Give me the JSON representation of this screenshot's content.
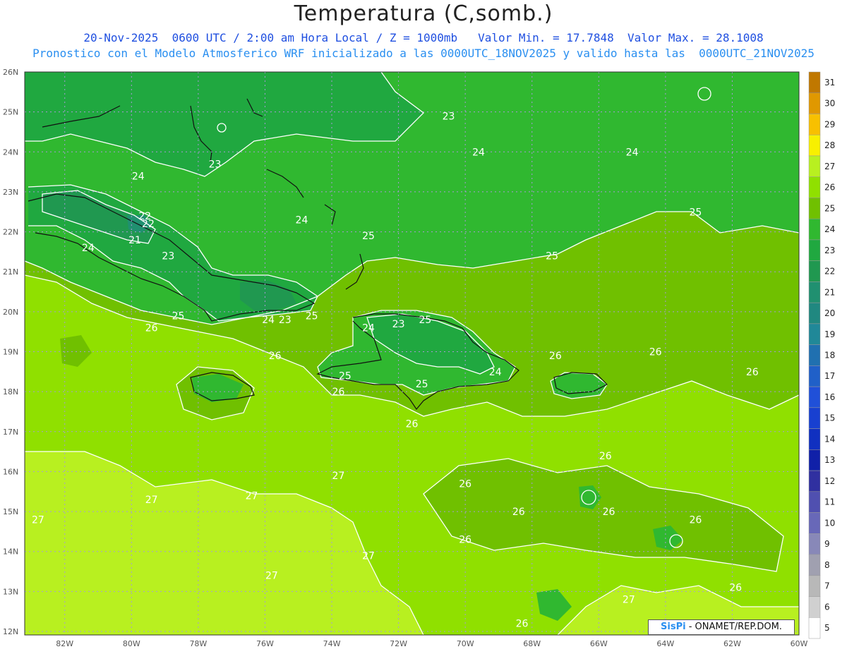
{
  "title": "Temperatura (C,somb.)",
  "subtitle1": "20-Nov-2025  0600 UTC / 2:00 am Hora Local / Z = 1000mb   Valor Min. = 17.7848  Valor Max. = 28.1008",
  "subtitle2": "Pronostico con el Modelo Atmosferico WRF inicializado a las 0000UTC_18NOV2025 y valido hasta las  0000UTC_21NOV2025",
  "credit": {
    "brand": "SisPi",
    "text": " - ONAMET/REP.DOM."
  },
  "axes": {
    "lat_labels": [
      "26N",
      "25N",
      "24N",
      "23N",
      "22N",
      "21N",
      "20N",
      "19N",
      "18N",
      "17N",
      "16N",
      "15N",
      "14N",
      "13N",
      "12N"
    ],
    "lon_labels": [
      "82W",
      "80W",
      "78W",
      "76W",
      "74W",
      "72W",
      "70W",
      "68W",
      "66W",
      "64W",
      "62W",
      "60W"
    ]
  },
  "colorbar": {
    "levels": [
      "31",
      "30",
      "29",
      "28",
      "27",
      "26",
      "25",
      "24",
      "23",
      "22",
      "21",
      "20",
      "19",
      "18",
      "17",
      "16",
      "15",
      "14",
      "13",
      "12",
      "11",
      "10",
      "9",
      "8",
      "7",
      "6",
      "5"
    ],
    "colors": [
      "#c07800",
      "#e09800",
      "#f8c000",
      "#f8f000",
      "#b8f020",
      "#90e000",
      "#70c000",
      "#30b830",
      "#20a840",
      "#209850",
      "#209070",
      "#208880",
      "#208898",
      "#2070b0",
      "#2060c8",
      "#2050d8",
      "#1840d0",
      "#1030c0",
      "#1020a8",
      "#3030a0",
      "#5050b0",
      "#6868b8",
      "#8888b8",
      "#a0a0b0",
      "#b8b8b8",
      "#d0d0d0",
      "#ffffff"
    ]
  },
  "field_colors": {
    "t21": "#209070",
    "t22": "#209850",
    "t23": "#20a840",
    "t24": "#30b830",
    "t25": "#70c000",
    "t26": "#90e000",
    "t27": "#b8f020",
    "t28": "#f8f000"
  },
  "contour_labels": [
    {
      "text": "23",
      "lon": -70.5,
      "lat": 24.9
    },
    {
      "text": "24",
      "lon": -65.0,
      "lat": 24.0
    },
    {
      "text": "24",
      "lon": -69.6,
      "lat": 24.0
    },
    {
      "text": "23",
      "lon": -77.5,
      "lat": 23.7
    },
    {
      "text": "24",
      "lon": -79.8,
      "lat": 23.4
    },
    {
      "text": "22",
      "lon": -79.6,
      "lat": 22.4
    },
    {
      "text": "22",
      "lon": -79.5,
      "lat": 22.2
    },
    {
      "text": "21",
      "lon": -79.9,
      "lat": 21.8
    },
    {
      "text": "24",
      "lon": -81.3,
      "lat": 21.6
    },
    {
      "text": "23",
      "lon": -78.9,
      "lat": 21.4
    },
    {
      "text": "24",
      "lon": -74.9,
      "lat": 22.3
    },
    {
      "text": "25",
      "lon": -72.9,
      "lat": 21.9
    },
    {
      "text": "25",
      "lon": -67.4,
      "lat": 21.4
    },
    {
      "text": "25",
      "lon": -63.1,
      "lat": 22.5
    },
    {
      "text": "25",
      "lon": -78.6,
      "lat": 19.9
    },
    {
      "text": "24",
      "lon": -75.9,
      "lat": 19.8
    },
    {
      "text": "23",
      "lon": -75.4,
      "lat": 19.8
    },
    {
      "text": "25",
      "lon": -74.6,
      "lat": 19.9
    },
    {
      "text": "26",
      "lon": -79.4,
      "lat": 19.6
    },
    {
      "text": "24",
      "lon": -72.9,
      "lat": 19.6
    },
    {
      "text": "23",
      "lon": -72.0,
      "lat": 19.7
    },
    {
      "text": "25",
      "lon": -71.2,
      "lat": 19.8
    },
    {
      "text": "26",
      "lon": -75.7,
      "lat": 18.9
    },
    {
      "text": "26",
      "lon": -67.3,
      "lat": 18.9
    },
    {
      "text": "26",
      "lon": -64.3,
      "lat": 19.0
    },
    {
      "text": "26",
      "lon": -61.4,
      "lat": 18.5
    },
    {
      "text": "24",
      "lon": -69.1,
      "lat": 18.5
    },
    {
      "text": "25",
      "lon": -71.3,
      "lat": 18.2
    },
    {
      "text": "25",
      "lon": -73.6,
      "lat": 18.4
    },
    {
      "text": "26",
      "lon": -73.8,
      "lat": 18.0
    },
    {
      "text": "26",
      "lon": -71.6,
      "lat": 17.2
    },
    {
      "text": "26",
      "lon": -65.8,
      "lat": 16.4
    },
    {
      "text": "27",
      "lon": -73.8,
      "lat": 15.9
    },
    {
      "text": "26",
      "lon": -70.0,
      "lat": 15.7
    },
    {
      "text": "27",
      "lon": -79.4,
      "lat": 15.3
    },
    {
      "text": "27",
      "lon": -76.4,
      "lat": 15.4
    },
    {
      "text": "26",
      "lon": -68.4,
      "lat": 15.0
    },
    {
      "text": "26",
      "lon": -65.7,
      "lat": 15.0
    },
    {
      "text": "26",
      "lon": -63.1,
      "lat": 14.8
    },
    {
      "text": "27",
      "lon": -82.8,
      "lat": 14.8
    },
    {
      "text": "26",
      "lon": -70.0,
      "lat": 14.3
    },
    {
      "text": "27",
      "lon": -72.9,
      "lat": 13.9
    },
    {
      "text": "27",
      "lon": -75.8,
      "lat": 13.4
    },
    {
      "text": "26",
      "lon": -61.9,
      "lat": 13.1
    },
    {
      "text": "27",
      "lon": -65.1,
      "lat": 12.8
    },
    {
      "text": "26",
      "lon": -68.3,
      "lat": 12.2
    }
  ]
}
